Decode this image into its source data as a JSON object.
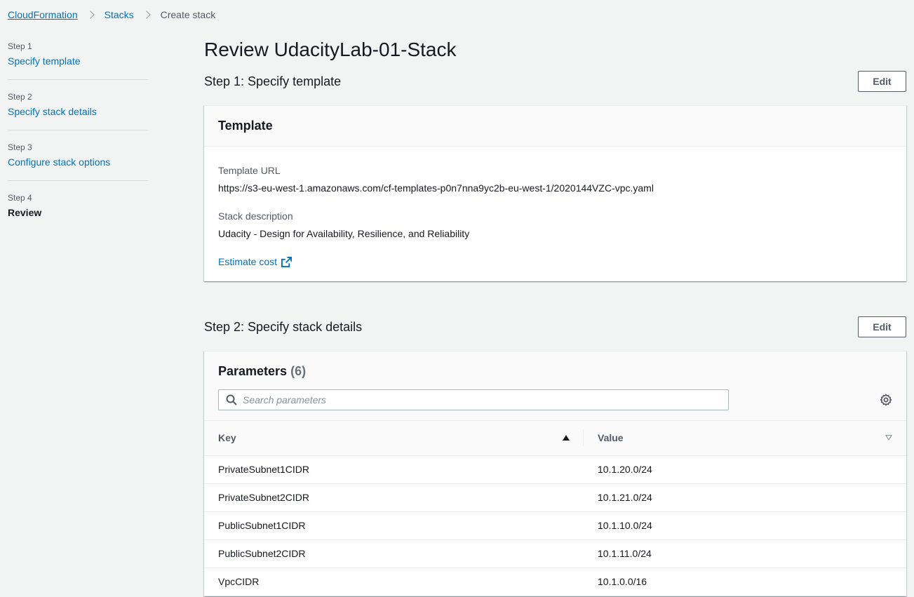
{
  "breadcrumb": {
    "items": [
      "CloudFormation",
      "Stacks"
    ],
    "current": "Create stack"
  },
  "steps": [
    {
      "num": "Step 1",
      "label": "Specify template"
    },
    {
      "num": "Step 2",
      "label": "Specify stack details"
    },
    {
      "num": "Step 3",
      "label": "Configure stack options"
    },
    {
      "num": "Step 4",
      "label": "Review"
    }
  ],
  "page": {
    "title": "Review UdacityLab-01-Stack"
  },
  "step1": {
    "title": "Step 1: Specify template",
    "edit_label": "Edit",
    "card_title": "Template",
    "template_url_label": "Template URL",
    "template_url": "https://s3-eu-west-1.amazonaws.com/cf-templates-p0n7nna9yc2b-eu-west-1/2020144VZC-vpc.yaml",
    "stack_description_label": "Stack description",
    "stack_description": "Udacity - Design for Availability, Resilience, and Reliability",
    "estimate_cost_label": "Estimate cost"
  },
  "step2": {
    "title": "Step 2: Specify stack details",
    "edit_label": "Edit",
    "params_title": "Parameters",
    "params_count": "(6)",
    "search_placeholder": "Search parameters",
    "columns": {
      "key": "Key",
      "value": "Value"
    },
    "rows": [
      {
        "key": "PrivateSubnet1CIDR",
        "value": "10.1.20.0/24"
      },
      {
        "key": "PrivateSubnet2CIDR",
        "value": "10.1.21.0/24"
      },
      {
        "key": "PublicSubnet1CIDR",
        "value": "10.1.10.0/24"
      },
      {
        "key": "PublicSubnet2CIDR",
        "value": "10.1.11.0/24"
      },
      {
        "key": "VpcCIDR",
        "value": "10.1.0.0/16"
      }
    ]
  },
  "colors": {
    "link": "#0073bb",
    "background": "#f2f3f3",
    "text": "#16191f"
  }
}
